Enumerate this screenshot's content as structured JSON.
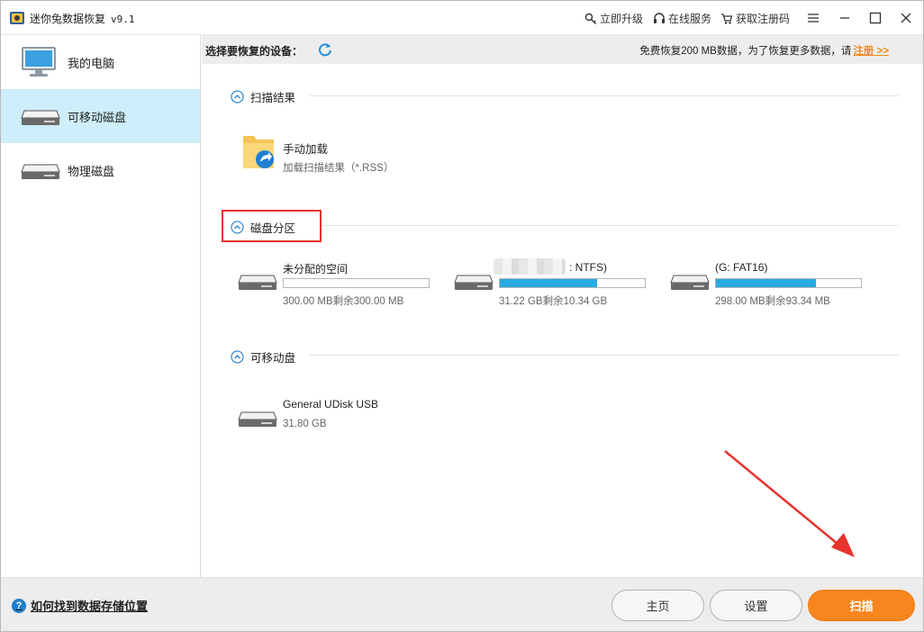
{
  "window": {
    "title": "迷你兔数据恢复",
    "version": "v9.1"
  },
  "toolbar": {
    "upgrade": "立即升级",
    "online_service": "在线服务",
    "get_code": "获取注册码"
  },
  "sidebar": {
    "items": [
      {
        "label": "我的电脑",
        "icon": "monitor-icon",
        "active": false
      },
      {
        "label": "可移动磁盘",
        "icon": "removable-disk-icon",
        "active": true
      },
      {
        "label": "物理磁盘",
        "icon": "physical-disk-icon",
        "active": false
      }
    ]
  },
  "header": {
    "select_device": "选择要恢复的设备：",
    "free_text": "免费恢复200 MB数据，为了恢复更多数据，请",
    "register_link": "注册 >>"
  },
  "sections": {
    "scan_results": {
      "title": "扫描结果",
      "manual_title": "手动加载",
      "manual_sub": "加载扫描结果（*.RSS）"
    },
    "partitions": {
      "title": "磁盘分区",
      "items": [
        {
          "name": "未分配的空间",
          "size": "300.00 MB剩余300.00 MB",
          "used": 0.0
        },
        {
          "name": ": NTFS)",
          "size": "31.22 GB剩余10.34 GB",
          "used": 0.67
        },
        {
          "name": "(G: FAT16)",
          "size": "298.00 MB剩余93.34 MB",
          "used": 0.69
        }
      ]
    },
    "removable": {
      "title": "可移动盘",
      "items": [
        {
          "name": "General UDisk USB",
          "size": "31.80 GB"
        }
      ]
    }
  },
  "footer": {
    "help_link": "如何找到数据存储位置",
    "home_button": "主页",
    "settings_button": "设置",
    "scan_button": "扫描"
  },
  "colors": {
    "accent": "#29aae3",
    "orange": "#f7861f",
    "active_item_bg": "#cdeefa",
    "annotation_red": "#e8332d"
  }
}
